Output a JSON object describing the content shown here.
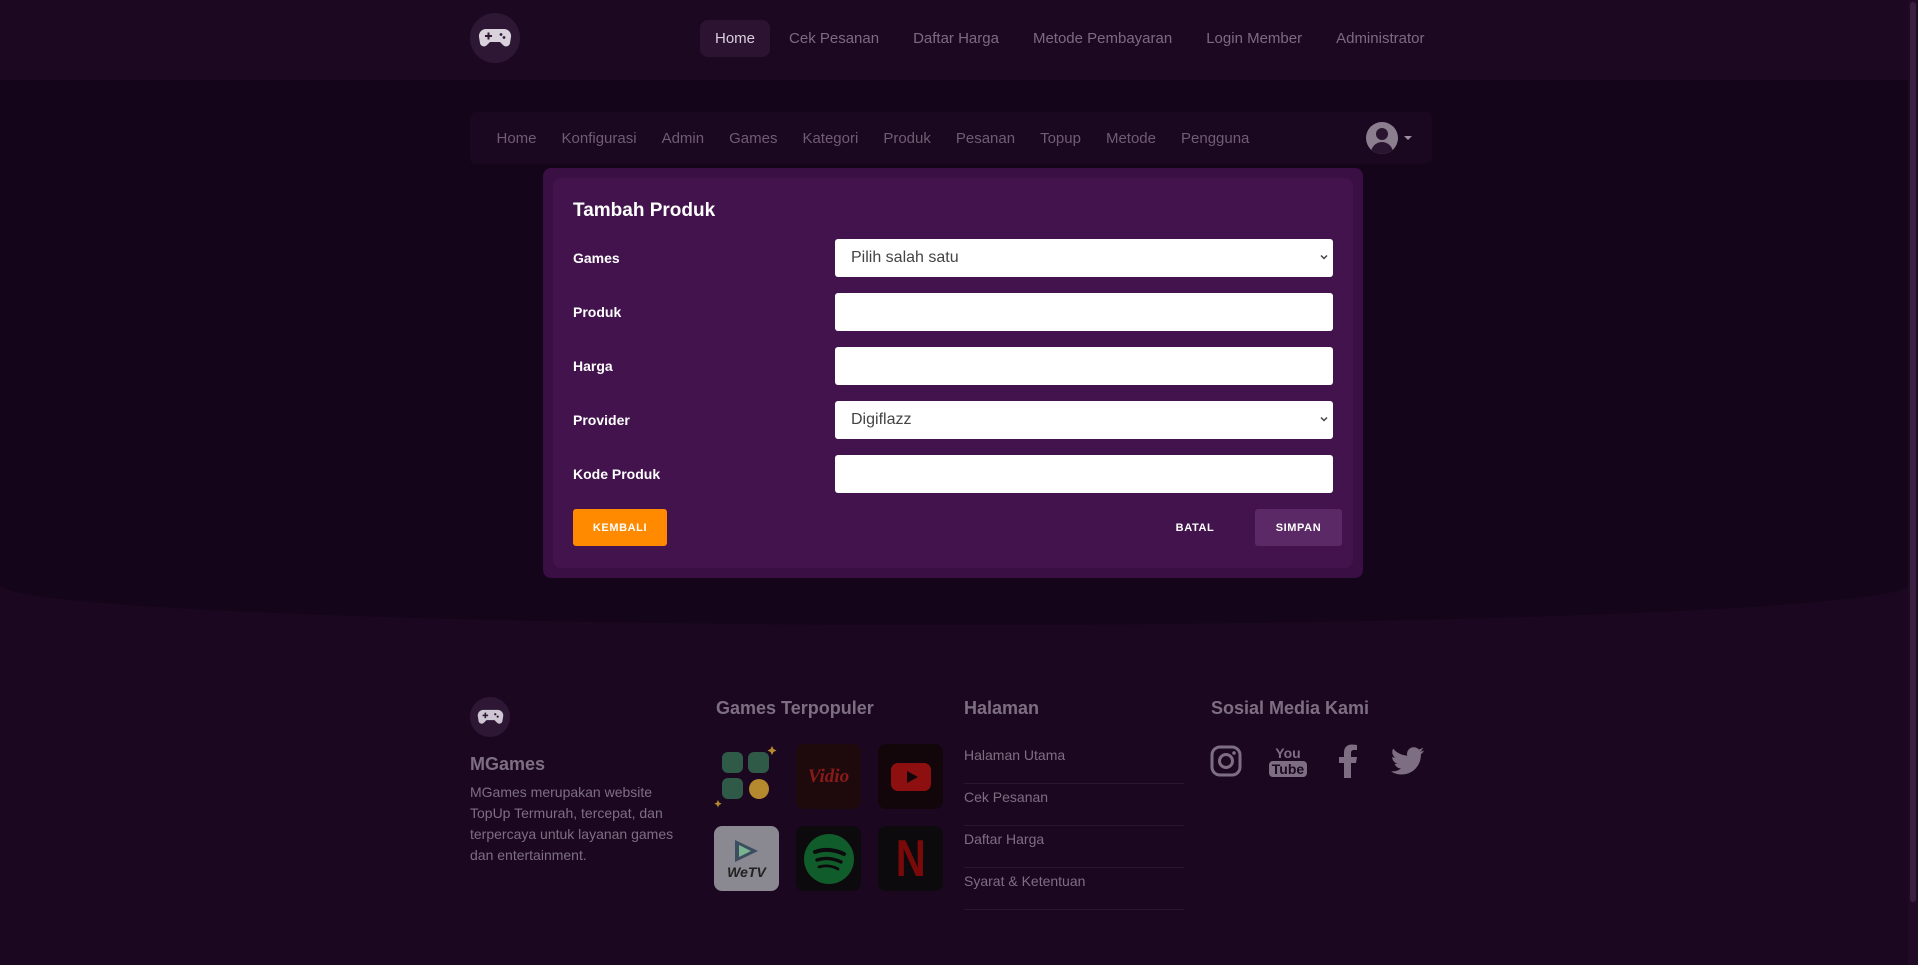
{
  "topnav": {
    "items": [
      {
        "label": "Home",
        "active": true
      },
      {
        "label": "Cek Pesanan"
      },
      {
        "label": "Daftar Harga"
      },
      {
        "label": "Metode Pembayaran"
      },
      {
        "label": "Login Member"
      },
      {
        "label": "Administrator"
      }
    ]
  },
  "adminnav": {
    "items": [
      "Home",
      "Konfigurasi",
      "Admin",
      "Games",
      "Kategori",
      "Produk",
      "Pesanan",
      "Topup",
      "Metode",
      "Pengguna"
    ]
  },
  "form": {
    "title": "Tambah Produk",
    "games_label": "Games",
    "games_value": "Pilih salah satu",
    "produk_label": "Produk",
    "produk_value": "",
    "harga_label": "Harga",
    "harga_value": "",
    "provider_label": "Provider",
    "provider_value": "Digiflazz",
    "kode_label": "Kode Produk",
    "kode_value": "",
    "back_label": "KEMBALI",
    "cancel_label": "BATAL",
    "save_label": "SIMPAN"
  },
  "footer": {
    "brand": "MGames",
    "description": "MGames merupakan website TopUp Termurah, tercepat, dan terpercaya untuk layanan games dan entertainment.",
    "popular_heading": "Games Terpopuler",
    "popular_tiles": [
      {
        "label": "",
        "icon": "apps-icon"
      },
      {
        "label": "Vidio",
        "icon": "vidio-logo"
      },
      {
        "label": "",
        "icon": "youtube-logo"
      },
      {
        "label": "WeTV",
        "icon": "wetv-logo"
      },
      {
        "label": "",
        "icon": "spotify-logo"
      },
      {
        "label": "N",
        "icon": "netflix-logo"
      }
    ],
    "pages_heading": "Halaman",
    "pages": [
      "Halaman Utama",
      "Cek Pesanan",
      "Daftar Harga",
      "Syarat & Ketentuan"
    ],
    "social_heading": "Sosial Media Kami",
    "social_icons": [
      "instagram-icon",
      "youtube-icon",
      "facebook-icon",
      "twitter-icon"
    ],
    "youtube_text_top": "You",
    "youtube_text_bottom": "Tube"
  },
  "colors": {
    "page_bg": "#1b0820",
    "modal_bg": "#42134c",
    "accent_orange": "#ff8a00",
    "save_button": "#5b2a66"
  }
}
